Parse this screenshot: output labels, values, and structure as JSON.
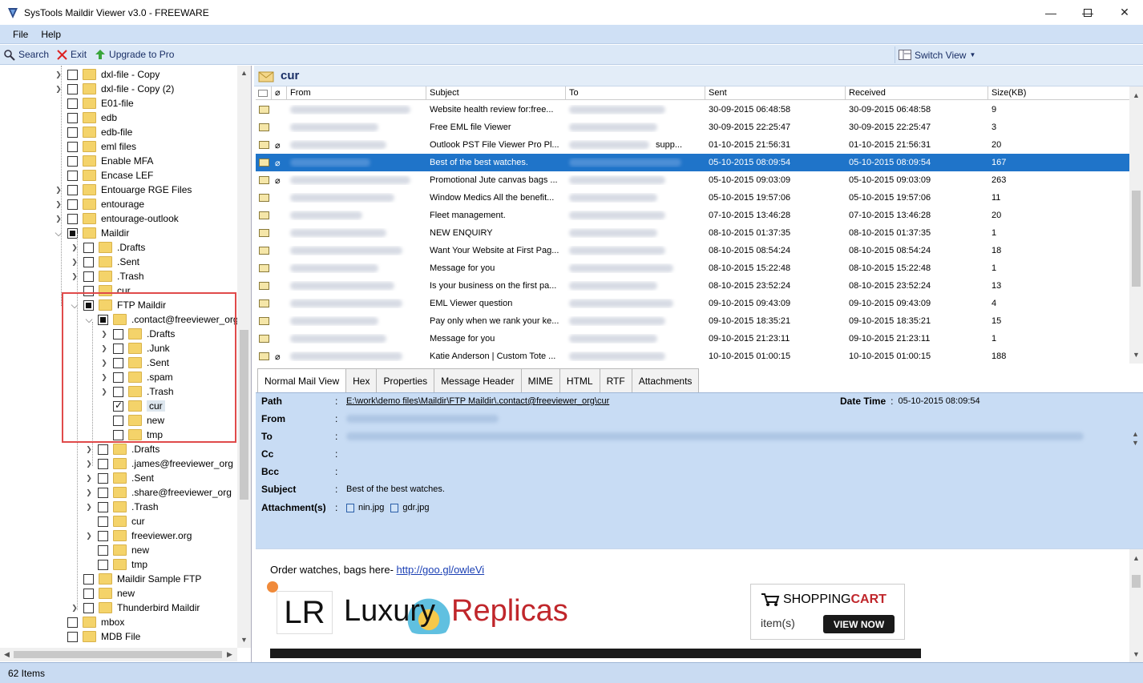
{
  "window": {
    "title": "SysTools Maildir Viewer v3.0 - FREEWARE"
  },
  "menu": {
    "file": "File",
    "help": "Help"
  },
  "toolbar": {
    "search": "Search",
    "exit": "Exit",
    "upgrade": "Upgrade to Pro",
    "switch_view": "Switch View"
  },
  "tree": [
    {
      "label": "dxl-file - Copy",
      "level": 0,
      "exp": true,
      "cb": "none"
    },
    {
      "label": "dxl-file - Copy (2)",
      "level": 0,
      "exp": true,
      "cb": "none"
    },
    {
      "label": "E01-file",
      "level": 0,
      "exp": false,
      "cb": "none"
    },
    {
      "label": "edb",
      "level": 0,
      "exp": false,
      "cb": "none"
    },
    {
      "label": "edb-file",
      "level": 0,
      "exp": false,
      "cb": "none"
    },
    {
      "label": "eml files",
      "level": 0,
      "exp": false,
      "cb": "none"
    },
    {
      "label": "Enable MFA",
      "level": 0,
      "exp": false,
      "cb": "none"
    },
    {
      "label": "Encase LEF",
      "level": 0,
      "exp": false,
      "cb": "none"
    },
    {
      "label": "Entouarge RGE Files",
      "level": 0,
      "exp": true,
      "cb": "none"
    },
    {
      "label": "entourage",
      "level": 0,
      "exp": true,
      "cb": "none"
    },
    {
      "label": "entourage-outlook",
      "level": 0,
      "exp": true,
      "cb": "none"
    },
    {
      "label": "Maildir",
      "level": 0,
      "exp": "open",
      "cb": "partial"
    },
    {
      "label": ".Drafts",
      "level": 1,
      "exp": true,
      "cb": "none"
    },
    {
      "label": ".Sent",
      "level": 1,
      "exp": true,
      "cb": "none"
    },
    {
      "label": ".Trash",
      "level": 1,
      "exp": true,
      "cb": "none"
    },
    {
      "label": "cur",
      "level": 1,
      "exp": false,
      "cb": "none"
    },
    {
      "label": "FTP Maildir",
      "level": 1,
      "exp": "open",
      "cb": "partial"
    },
    {
      "label": ".contact@freeviewer_org",
      "level": 2,
      "exp": "open",
      "cb": "partial"
    },
    {
      "label": ".Drafts",
      "level": 3,
      "exp": true,
      "cb": "none"
    },
    {
      "label": ".Junk",
      "level": 3,
      "exp": true,
      "cb": "none"
    },
    {
      "label": ".Sent",
      "level": 3,
      "exp": true,
      "cb": "none"
    },
    {
      "label": ".spam",
      "level": 3,
      "exp": true,
      "cb": "none"
    },
    {
      "label": ".Trash",
      "level": 3,
      "exp": true,
      "cb": "none"
    },
    {
      "label": "cur",
      "level": 3,
      "exp": false,
      "cb": "checked",
      "selected": true
    },
    {
      "label": "new",
      "level": 3,
      "exp": false,
      "cb": "none"
    },
    {
      "label": "tmp",
      "level": 3,
      "exp": false,
      "cb": "none"
    },
    {
      "label": ".Drafts",
      "level": 2,
      "exp": true,
      "cb": "none"
    },
    {
      "label": ".james@freeviewer_org",
      "level": 2,
      "exp": true,
      "cb": "none"
    },
    {
      "label": ".Sent",
      "level": 2,
      "exp": true,
      "cb": "none"
    },
    {
      "label": ".share@freeviewer_org",
      "level": 2,
      "exp": true,
      "cb": "none"
    },
    {
      "label": ".Trash",
      "level": 2,
      "exp": true,
      "cb": "none"
    },
    {
      "label": "cur",
      "level": 2,
      "exp": false,
      "cb": "none"
    },
    {
      "label": "freeviewer.org",
      "level": 2,
      "exp": true,
      "cb": "none"
    },
    {
      "label": "new",
      "level": 2,
      "exp": false,
      "cb": "none"
    },
    {
      "label": "tmp",
      "level": 2,
      "exp": false,
      "cb": "none"
    },
    {
      "label": "Maildir Sample FTP",
      "level": 1,
      "exp": false,
      "cb": "none"
    },
    {
      "label": "new",
      "level": 1,
      "exp": false,
      "cb": "none"
    },
    {
      "label": "Thunderbird Maildir",
      "level": 1,
      "exp": true,
      "cb": "none"
    },
    {
      "label": "mbox",
      "level": 0,
      "exp": false,
      "cb": "none"
    },
    {
      "label": "MDB File",
      "level": 0,
      "exp": false,
      "cb": "none"
    }
  ],
  "folder_header": "cur",
  "grid": {
    "columns": [
      "From",
      "Subject",
      "To",
      "Sent",
      "Received",
      "Size(KB)"
    ],
    "rows": [
      {
        "subject": "Website health review for:free...",
        "sent": "30-09-2015 06:48:58",
        "received": "30-09-2015 06:48:58",
        "size": "9",
        "attach": false,
        "to_suffix": ""
      },
      {
        "subject": "Free EML file Viewer",
        "sent": "30-09-2015 22:25:47",
        "received": "30-09-2015 22:25:47",
        "size": "3",
        "attach": false,
        "to_suffix": ""
      },
      {
        "subject": "Outlook PST File Viewer Pro Pl...",
        "sent": "01-10-2015 21:56:31",
        "received": "01-10-2015 21:56:31",
        "size": "20",
        "attach": true,
        "to_suffix": "supp..."
      },
      {
        "subject": "Best of the best watches.",
        "sent": "05-10-2015 08:09:54",
        "received": "05-10-2015 08:09:54",
        "size": "167",
        "attach": true,
        "to_suffix": "",
        "selected": true
      },
      {
        "subject": "Promotional Jute canvas bags ...",
        "sent": "05-10-2015 09:03:09",
        "received": "05-10-2015 09:03:09",
        "size": "263",
        "attach": true,
        "to_suffix": ""
      },
      {
        "subject": "Window Medics All the benefit...",
        "sent": "05-10-2015 19:57:06",
        "received": "05-10-2015 19:57:06",
        "size": "11",
        "attach": false,
        "to_suffix": ""
      },
      {
        "subject": "Fleet management.",
        "sent": "07-10-2015 13:46:28",
        "received": "07-10-2015 13:46:28",
        "size": "20",
        "attach": false,
        "to_suffix": ""
      },
      {
        "subject": "NEW ENQUIRY",
        "sent": "08-10-2015 01:37:35",
        "received": "08-10-2015 01:37:35",
        "size": "1",
        "attach": false,
        "to_suffix": ""
      },
      {
        "subject": "Want Your Website at First Pag...",
        "sent": "08-10-2015 08:54:24",
        "received": "08-10-2015 08:54:24",
        "size": "18",
        "attach": false,
        "to_suffix": ""
      },
      {
        "subject": "Message for you",
        "sent": "08-10-2015 15:22:48",
        "received": "08-10-2015 15:22:48",
        "size": "1",
        "attach": false,
        "to_suffix": ""
      },
      {
        "subject": "Is your business on the first pa...",
        "sent": "08-10-2015 23:52:24",
        "received": "08-10-2015 23:52:24",
        "size": "13",
        "attach": false,
        "to_suffix": ""
      },
      {
        "subject": "EML Viewer question",
        "sent": "09-10-2015 09:43:09",
        "received": "09-10-2015 09:43:09",
        "size": "4",
        "attach": false,
        "to_suffix": ""
      },
      {
        "subject": "Pay only when we rank your ke...",
        "sent": "09-10-2015 18:35:21",
        "received": "09-10-2015 18:35:21",
        "size": "15",
        "attach": false,
        "to_suffix": ""
      },
      {
        "subject": "Message for you",
        "sent": "09-10-2015 21:23:11",
        "received": "09-10-2015 21:23:11",
        "size": "1",
        "attach": false,
        "to_suffix": ""
      },
      {
        "subject": "Katie Anderson | Custom Tote ...",
        "sent": "10-10-2015 01:00:15",
        "received": "10-10-2015 01:00:15",
        "size": "188",
        "attach": true,
        "to_suffix": ""
      }
    ]
  },
  "tabs": [
    "Normal Mail View",
    "Hex",
    "Properties",
    "Message Header",
    "MIME",
    "HTML",
    "RTF",
    "Attachments"
  ],
  "meta": {
    "path_label": "Path",
    "path_value": "E:\\work\\demo files\\Maildir\\FTP Maildir\\.contact@freeviewer_org\\cur",
    "date_label": "Date Time",
    "date_value": "05-10-2015 08:09:54",
    "from_label": "From",
    "to_label": "To",
    "cc_label": "Cc",
    "bcc_label": "Bcc",
    "subject_label": "Subject",
    "subject_value": "Best of the best watches.",
    "attach_label": "Attachment(s)",
    "attachments": [
      "nin.jpg",
      "gdr.jpg"
    ]
  },
  "body": {
    "intro": "Order watches, bags here- ",
    "link": "http://goo.gl/owleVi",
    "logo_lr": "LR",
    "logo_luxury": "Luxury",
    "logo_replicas": "Replicas",
    "cart_title_a": "SHOPPING ",
    "cart_title_b": "CART",
    "cart_items": "item(s)",
    "cart_button": "VIEW NOW"
  },
  "status": {
    "items": "62 Items"
  },
  "colors": {
    "selection": "#1f74c9",
    "highlight_box": "#e04a4a",
    "toolbar_bg": "#dbe8f7",
    "meta_bg": "#c8dcf4"
  }
}
